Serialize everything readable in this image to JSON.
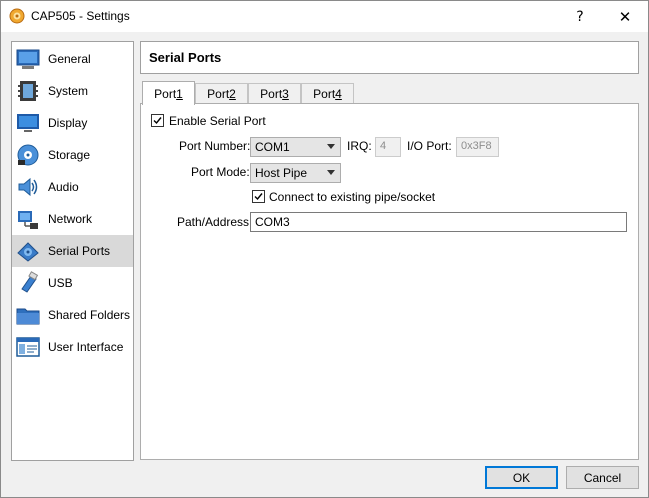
{
  "window": {
    "title": "CAP505 - Settings",
    "help_glyph": "?",
    "close_glyph": "✕"
  },
  "sidebar": {
    "items": [
      {
        "label": "General",
        "icon": "general-icon"
      },
      {
        "label": "System",
        "icon": "system-icon"
      },
      {
        "label": "Display",
        "icon": "display-icon"
      },
      {
        "label": "Storage",
        "icon": "storage-icon"
      },
      {
        "label": "Audio",
        "icon": "audio-icon"
      },
      {
        "label": "Network",
        "icon": "network-icon"
      },
      {
        "label": "Serial Ports",
        "icon": "serial-ports-icon",
        "selected": true
      },
      {
        "label": "USB",
        "icon": "usb-icon"
      },
      {
        "label": "Shared Folders",
        "icon": "shared-folders-icon"
      },
      {
        "label": "User Interface",
        "icon": "user-interface-icon"
      }
    ]
  },
  "header": {
    "title": "Serial Ports"
  },
  "tabs": [
    {
      "label_pre": "Port ",
      "label_key": "1",
      "active": true
    },
    {
      "label_pre": "Port ",
      "label_key": "2",
      "active": false
    },
    {
      "label_pre": "Port ",
      "label_key": "3",
      "active": false
    },
    {
      "label_pre": "Port ",
      "label_key": "4",
      "active": false
    }
  ],
  "form": {
    "enable": {
      "label": "Enable Serial Port",
      "checked": true
    },
    "port_number": {
      "label": "Port Number:",
      "value": "COM1"
    },
    "irq": {
      "label": "IRQ:",
      "value": "4"
    },
    "io_port": {
      "label": "I/O Port:",
      "value": "0x3F8"
    },
    "port_mode": {
      "label": "Port Mode:",
      "value": "Host Pipe"
    },
    "connect": {
      "label": "Connect to existing pipe/socket",
      "checked": true
    },
    "path": {
      "label": "Path/Address:",
      "value": "COM3"
    }
  },
  "buttons": {
    "ok": "OK",
    "cancel": "Cancel"
  },
  "colors": {
    "accent": "#0078d7",
    "selection": "#d9d9d9"
  }
}
